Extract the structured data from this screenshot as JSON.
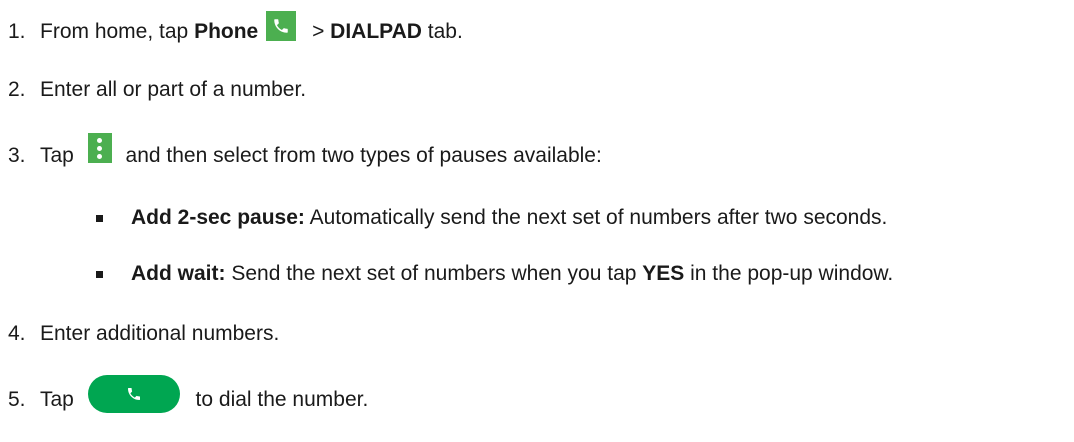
{
  "steps": [
    {
      "number": "1.",
      "text_a": "From home, tap ",
      "bold_a": "Phone",
      "text_b": " > ",
      "bold_b": "DIALPAD",
      "text_c": " tab."
    },
    {
      "number": "2.",
      "text": "Enter all or part of a number."
    },
    {
      "number": "3.",
      "text_a": "Tap ",
      "text_b": " and then select from two types of pauses available:"
    },
    {
      "number": "4.",
      "text": "Enter additional numbers."
    },
    {
      "number": "5.",
      "text_a": "Tap ",
      "text_b": " to dial the number."
    }
  ],
  "pause_options": [
    {
      "label": "Add 2-sec pause:",
      "description": " Automatically send the next set of numbers after two seconds."
    },
    {
      "label": "Add wait:",
      "description_a": " Send the next set of numbers when you tap ",
      "bold": "YES",
      "description_b": " in the pop-up window."
    }
  ],
  "icons": {
    "phone_app": "phone-icon",
    "menu": "more-vertical-icon",
    "call": "call-button-icon"
  },
  "colors": {
    "icon_green": "#4caf50",
    "call_green": "#00a651"
  }
}
